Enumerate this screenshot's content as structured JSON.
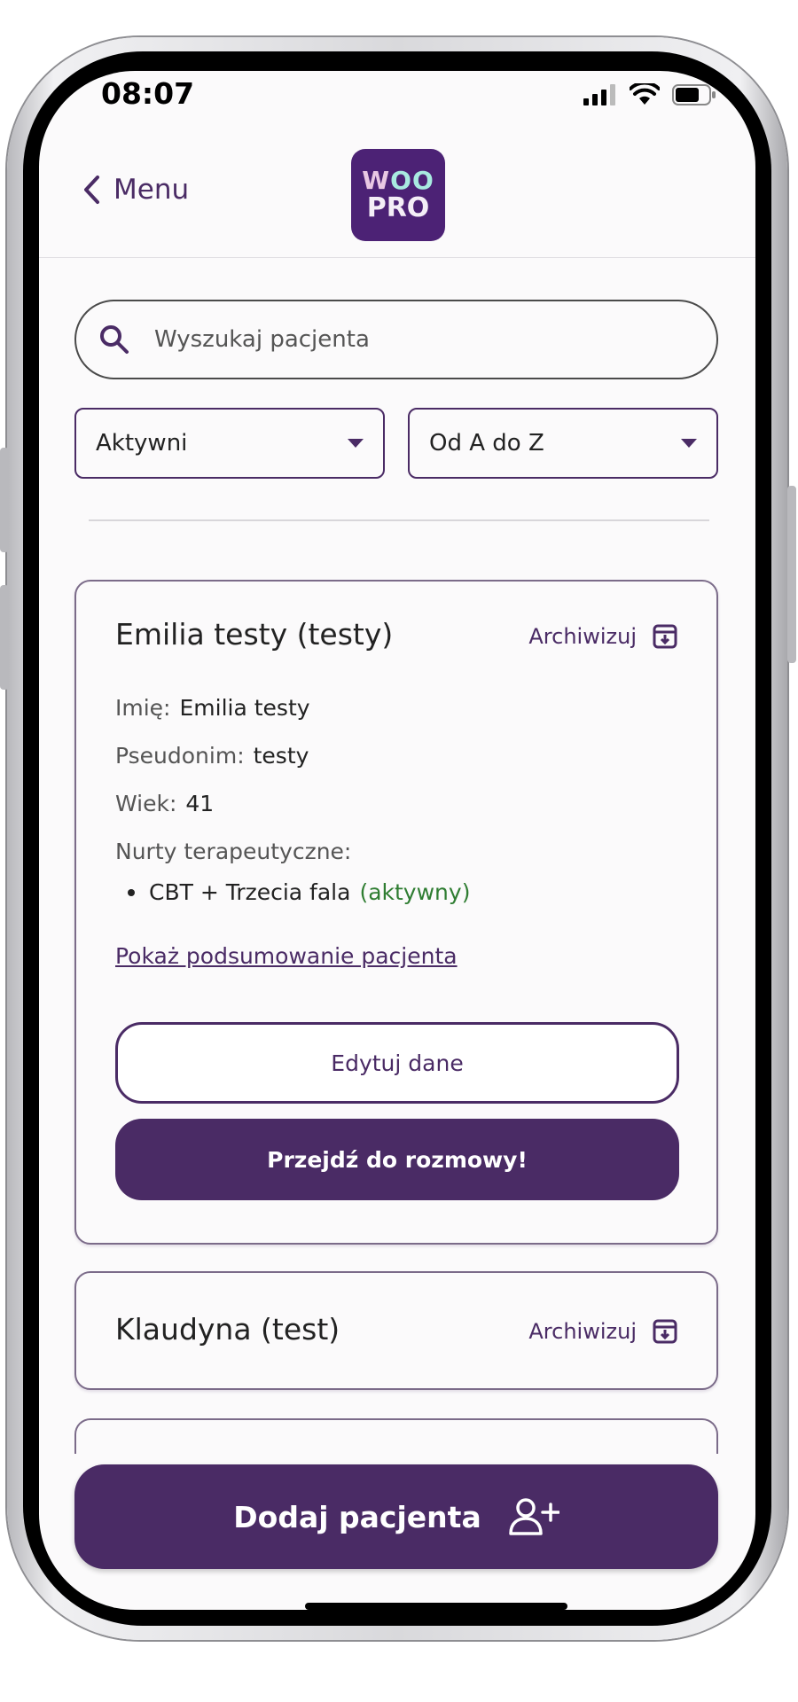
{
  "status_bar": {
    "time": "08:07"
  },
  "header": {
    "back_label": "Menu",
    "logo_line1_a": "W",
    "logo_line1_b": "OO",
    "logo_line2": "PRO"
  },
  "search": {
    "placeholder": "Wyszukaj pacjenta"
  },
  "filters": {
    "status": "Aktywni",
    "sort": "Od A do Z"
  },
  "patients": [
    {
      "title": "Emilia testy (testy)",
      "archive_label": "Archiwizuj",
      "name_label": "Imię:",
      "name_value": "Emilia testy",
      "nickname_label": "Pseudonim:",
      "nickname_value": "testy",
      "age_label": "Wiek:",
      "age_value": "41",
      "therapies_label": "Nurty terapeutyczne:",
      "therapy": "CBT + Trzecia fala",
      "therapy_status": "(aktywny)",
      "summary_link": "Pokaż podsumowanie pacjenta",
      "edit_button": "Edytuj dane",
      "chat_button": "Przejdź do rozmowy!"
    },
    {
      "title": "Klaudyna (test)",
      "archive_label": "Archiwizuj"
    }
  ],
  "add_patient_button": "Dodaj pacjenta",
  "colors": {
    "primary": "#4a2b65",
    "logo_bg": "#4c2275",
    "active_status": "#2f7d32"
  }
}
